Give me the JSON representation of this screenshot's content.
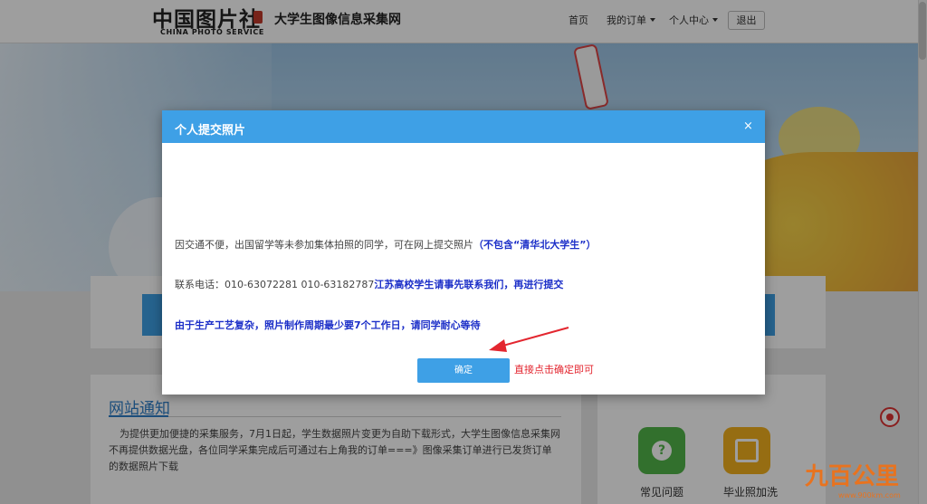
{
  "header": {
    "logo_cn": "中国图片社",
    "logo_en": "CHINA PHOTO SERVICE",
    "logo_sub": "大学生图像信息采集网",
    "nav": {
      "home": "首页",
      "orders": "我的订单",
      "user_center": "个人中心",
      "logout": "退出"
    }
  },
  "page": {
    "notice_title": "网站通知",
    "notice_text": "为提供更加便捷的采集服务，7月1日起，学生数据照片变更为自助下载形式，大学生图像信息采集网不再提供数据光盘，各位同学采集完成后可通过右上角我的订单===》图像采集订单进行已发货订单的数据照片下载",
    "services": {
      "faq_label": "常见问题",
      "faq_glyph": "?",
      "photo_label": "毕业照加洗"
    }
  },
  "modal": {
    "title": "个人提交照片",
    "close_glyph": "×",
    "line1_plain": "因交通不便，出国留学等未参加集体拍照的同学，可在网上提交照片",
    "line1_emph": "（不包含“清华北大学生”）",
    "line2_plain": "联系电话：010-63072281 010-63182787",
    "line2_emph": "江苏高校学生请事先联系我们，再进行提交",
    "line3_emph": "由于生产工艺复杂，照片制作周期最少要7个工作日，请同学耐心等待",
    "confirm_label": "确定"
  },
  "annotation": {
    "text": "直接点击确定即可",
    "color": "#e3262f"
  },
  "watermark": {
    "logo": "九百公里",
    "url": "www.900km.com"
  },
  "colors": {
    "accent_blue": "#3ea0e6",
    "emphasis_blue": "#1c2fc8",
    "annotation_red": "#e3262f"
  }
}
